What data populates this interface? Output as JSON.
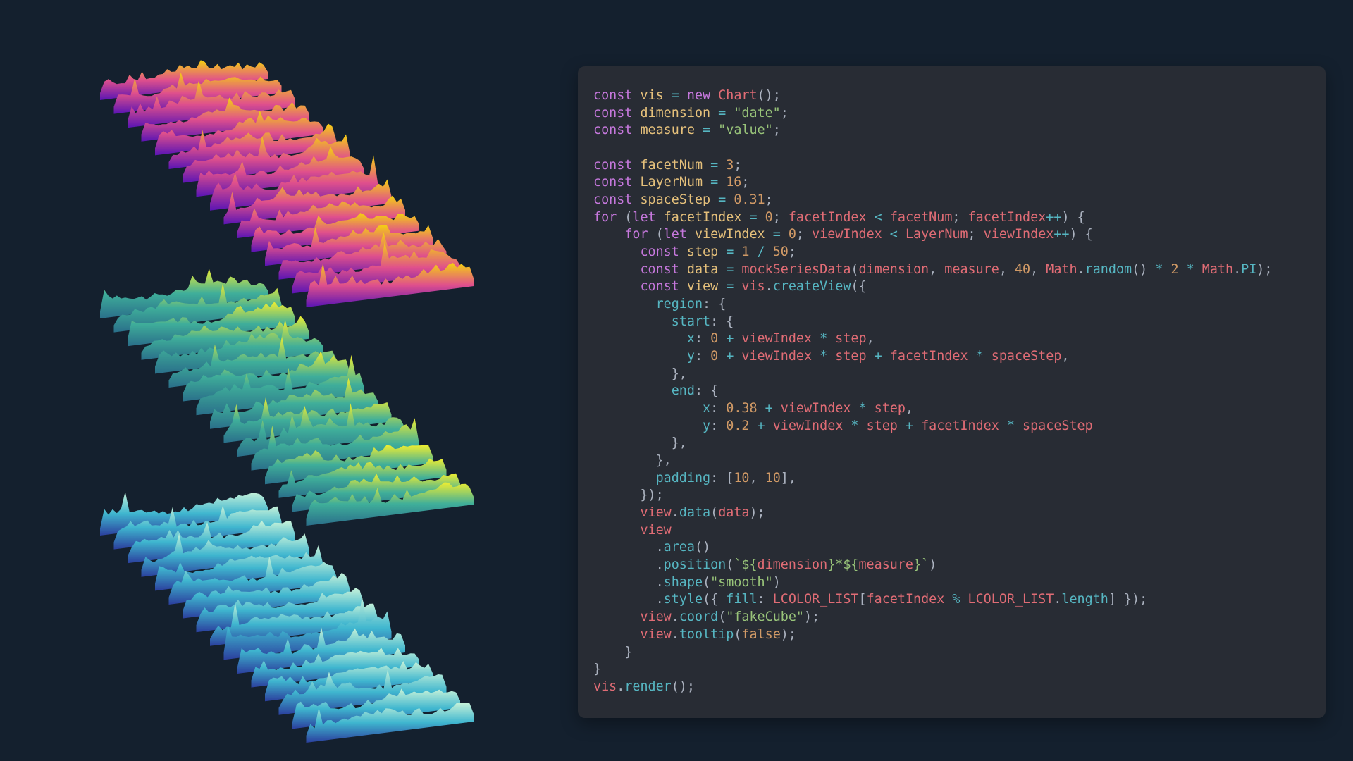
{
  "visualization": {
    "description_name": "stacked area layers",
    "facets": [
      {
        "gradient": {
          "top": "#f5d20f",
          "mid": "#e0508c",
          "bottom": "#5a14b4"
        },
        "layers": 16
      },
      {
        "gradient": {
          "top": "#f0ee30",
          "mid": "#3fae9a",
          "bottom": "#2a6f8a"
        },
        "layers": 16
      },
      {
        "gradient": {
          "top": "#c9f3d9",
          "mid": "#3fb6cf",
          "bottom": "#2b3f9e"
        },
        "layers": 16
      }
    ]
  },
  "code": {
    "lines": [
      [
        {
          "t": "k",
          "v": "const "
        },
        {
          "t": "v",
          "v": "vis"
        },
        {
          "t": "o",
          "v": " = "
        },
        {
          "t": "k",
          "v": "new "
        },
        {
          "t": "f",
          "v": "Chart"
        },
        {
          "t": "p",
          "v": "();"
        }
      ],
      [
        {
          "t": "k",
          "v": "const "
        },
        {
          "t": "v",
          "v": "dimension"
        },
        {
          "t": "o",
          "v": " = "
        },
        {
          "t": "s",
          "v": "\"date\""
        },
        {
          "t": "p",
          "v": ";"
        }
      ],
      [
        {
          "t": "k",
          "v": "const "
        },
        {
          "t": "v",
          "v": "measure"
        },
        {
          "t": "o",
          "v": " = "
        },
        {
          "t": "s",
          "v": "\"value\""
        },
        {
          "t": "p",
          "v": ";"
        }
      ],
      [],
      [
        {
          "t": "k",
          "v": "const "
        },
        {
          "t": "v",
          "v": "facetNum"
        },
        {
          "t": "o",
          "v": " = "
        },
        {
          "t": "n",
          "v": "3"
        },
        {
          "t": "p",
          "v": ";"
        }
      ],
      [
        {
          "t": "k",
          "v": "const "
        },
        {
          "t": "v",
          "v": "LayerNum"
        },
        {
          "t": "o",
          "v": " = "
        },
        {
          "t": "n",
          "v": "16"
        },
        {
          "t": "p",
          "v": ";"
        }
      ],
      [
        {
          "t": "k",
          "v": "const "
        },
        {
          "t": "v",
          "v": "spaceStep"
        },
        {
          "t": "o",
          "v": " = "
        },
        {
          "t": "n",
          "v": "0.31"
        },
        {
          "t": "p",
          "v": ";"
        }
      ],
      [
        {
          "t": "k",
          "v": "for "
        },
        {
          "t": "p",
          "v": "("
        },
        {
          "t": "k",
          "v": "let "
        },
        {
          "t": "v",
          "v": "facetIndex"
        },
        {
          "t": "o",
          "v": " = "
        },
        {
          "t": "n",
          "v": "0"
        },
        {
          "t": "p",
          "v": "; "
        },
        {
          "t": "f",
          "v": "facetIndex"
        },
        {
          "t": "o",
          "v": " < "
        },
        {
          "t": "f",
          "v": "facetNum"
        },
        {
          "t": "p",
          "v": "; "
        },
        {
          "t": "f",
          "v": "facetIndex"
        },
        {
          "t": "o",
          "v": "++"
        },
        {
          "t": "p",
          "v": ") {"
        }
      ],
      [
        {
          "t": "x",
          "v": "    "
        },
        {
          "t": "k",
          "v": "for "
        },
        {
          "t": "p",
          "v": "("
        },
        {
          "t": "k",
          "v": "let "
        },
        {
          "t": "v",
          "v": "viewIndex"
        },
        {
          "t": "o",
          "v": " = "
        },
        {
          "t": "n",
          "v": "0"
        },
        {
          "t": "p",
          "v": "; "
        },
        {
          "t": "f",
          "v": "viewIndex"
        },
        {
          "t": "o",
          "v": " < "
        },
        {
          "t": "f",
          "v": "LayerNum"
        },
        {
          "t": "p",
          "v": "; "
        },
        {
          "t": "f",
          "v": "viewIndex"
        },
        {
          "t": "o",
          "v": "++"
        },
        {
          "t": "p",
          "v": ") {"
        }
      ],
      [
        {
          "t": "x",
          "v": "      "
        },
        {
          "t": "k",
          "v": "const "
        },
        {
          "t": "v",
          "v": "step"
        },
        {
          "t": "o",
          "v": " = "
        },
        {
          "t": "n",
          "v": "1"
        },
        {
          "t": "o",
          "v": " / "
        },
        {
          "t": "n",
          "v": "50"
        },
        {
          "t": "p",
          "v": ";"
        }
      ],
      [
        {
          "t": "x",
          "v": "      "
        },
        {
          "t": "k",
          "v": "const "
        },
        {
          "t": "v",
          "v": "data"
        },
        {
          "t": "o",
          "v": " = "
        },
        {
          "t": "f",
          "v": "mockSeriesData"
        },
        {
          "t": "p",
          "v": "("
        },
        {
          "t": "f",
          "v": "dimension"
        },
        {
          "t": "p",
          "v": ", "
        },
        {
          "t": "f",
          "v": "measure"
        },
        {
          "t": "p",
          "v": ", "
        },
        {
          "t": "n",
          "v": "40"
        },
        {
          "t": "p",
          "v": ", "
        },
        {
          "t": "f",
          "v": "Math"
        },
        {
          "t": "p",
          "v": "."
        },
        {
          "t": "o",
          "v": "random"
        },
        {
          "t": "p",
          "v": "()"
        },
        {
          "t": "o",
          "v": " * "
        },
        {
          "t": "n",
          "v": "2"
        },
        {
          "t": "o",
          "v": " * "
        },
        {
          "t": "f",
          "v": "Math"
        },
        {
          "t": "p",
          "v": "."
        },
        {
          "t": "o",
          "v": "PI"
        },
        {
          "t": "p",
          "v": ");"
        }
      ],
      [
        {
          "t": "x",
          "v": "      "
        },
        {
          "t": "k",
          "v": "const "
        },
        {
          "t": "v",
          "v": "view"
        },
        {
          "t": "o",
          "v": " = "
        },
        {
          "t": "f",
          "v": "vis"
        },
        {
          "t": "p",
          "v": "."
        },
        {
          "t": "o",
          "v": "createView"
        },
        {
          "t": "p",
          "v": "({"
        }
      ],
      [
        {
          "t": "x",
          "v": "        "
        },
        {
          "t": "o",
          "v": "region"
        },
        {
          "t": "p",
          "v": ": {"
        }
      ],
      [
        {
          "t": "x",
          "v": "          "
        },
        {
          "t": "o",
          "v": "start"
        },
        {
          "t": "p",
          "v": ": {"
        }
      ],
      [
        {
          "t": "x",
          "v": "            "
        },
        {
          "t": "o",
          "v": "x"
        },
        {
          "t": "p",
          "v": ": "
        },
        {
          "t": "n",
          "v": "0"
        },
        {
          "t": "o",
          "v": " + "
        },
        {
          "t": "f",
          "v": "viewIndex"
        },
        {
          "t": "o",
          "v": " * "
        },
        {
          "t": "f",
          "v": "step"
        },
        {
          "t": "p",
          "v": ","
        }
      ],
      [
        {
          "t": "x",
          "v": "            "
        },
        {
          "t": "o",
          "v": "y"
        },
        {
          "t": "p",
          "v": ": "
        },
        {
          "t": "n",
          "v": "0"
        },
        {
          "t": "o",
          "v": " + "
        },
        {
          "t": "f",
          "v": "viewIndex"
        },
        {
          "t": "o",
          "v": " * "
        },
        {
          "t": "f",
          "v": "step"
        },
        {
          "t": "o",
          "v": " + "
        },
        {
          "t": "f",
          "v": "facetIndex"
        },
        {
          "t": "o",
          "v": " * "
        },
        {
          "t": "f",
          "v": "spaceStep"
        },
        {
          "t": "p",
          "v": ","
        }
      ],
      [
        {
          "t": "x",
          "v": "          "
        },
        {
          "t": "p",
          "v": "},"
        }
      ],
      [
        {
          "t": "x",
          "v": "          "
        },
        {
          "t": "o",
          "v": "end"
        },
        {
          "t": "p",
          "v": ": {"
        }
      ],
      [
        {
          "t": "x",
          "v": "              "
        },
        {
          "t": "o",
          "v": "x"
        },
        {
          "t": "p",
          "v": ": "
        },
        {
          "t": "n",
          "v": "0.38"
        },
        {
          "t": "o",
          "v": " + "
        },
        {
          "t": "f",
          "v": "viewIndex"
        },
        {
          "t": "o",
          "v": " * "
        },
        {
          "t": "f",
          "v": "step"
        },
        {
          "t": "p",
          "v": ","
        }
      ],
      [
        {
          "t": "x",
          "v": "              "
        },
        {
          "t": "o",
          "v": "y"
        },
        {
          "t": "p",
          "v": ": "
        },
        {
          "t": "n",
          "v": "0.2"
        },
        {
          "t": "o",
          "v": " + "
        },
        {
          "t": "f",
          "v": "viewIndex"
        },
        {
          "t": "o",
          "v": " * "
        },
        {
          "t": "f",
          "v": "step"
        },
        {
          "t": "o",
          "v": " + "
        },
        {
          "t": "f",
          "v": "facetIndex"
        },
        {
          "t": "o",
          "v": " * "
        },
        {
          "t": "f",
          "v": "spaceStep"
        }
      ],
      [
        {
          "t": "x",
          "v": "          "
        },
        {
          "t": "p",
          "v": "},"
        }
      ],
      [
        {
          "t": "x",
          "v": "        "
        },
        {
          "t": "p",
          "v": "},"
        }
      ],
      [
        {
          "t": "x",
          "v": "        "
        },
        {
          "t": "o",
          "v": "padding"
        },
        {
          "t": "p",
          "v": ": ["
        },
        {
          "t": "n",
          "v": "10"
        },
        {
          "t": "p",
          "v": ", "
        },
        {
          "t": "n",
          "v": "10"
        },
        {
          "t": "p",
          "v": "],"
        }
      ],
      [
        {
          "t": "x",
          "v": "      "
        },
        {
          "t": "p",
          "v": "});"
        }
      ],
      [
        {
          "t": "x",
          "v": "      "
        },
        {
          "t": "f",
          "v": "view"
        },
        {
          "t": "p",
          "v": "."
        },
        {
          "t": "o",
          "v": "data"
        },
        {
          "t": "p",
          "v": "("
        },
        {
          "t": "f",
          "v": "data"
        },
        {
          "t": "p",
          "v": ");"
        }
      ],
      [
        {
          "t": "x",
          "v": "      "
        },
        {
          "t": "f",
          "v": "view"
        }
      ],
      [
        {
          "t": "x",
          "v": "        "
        },
        {
          "t": "p",
          "v": "."
        },
        {
          "t": "o",
          "v": "area"
        },
        {
          "t": "p",
          "v": "()"
        }
      ],
      [
        {
          "t": "x",
          "v": "        "
        },
        {
          "t": "p",
          "v": "."
        },
        {
          "t": "o",
          "v": "position"
        },
        {
          "t": "p",
          "v": "("
        },
        {
          "t": "s",
          "v": "`${"
        },
        {
          "t": "f",
          "v": "dimension"
        },
        {
          "t": "s",
          "v": "}*${"
        },
        {
          "t": "f",
          "v": "measure"
        },
        {
          "t": "s",
          "v": "}`"
        },
        {
          "t": "p",
          "v": ")"
        }
      ],
      [
        {
          "t": "x",
          "v": "        "
        },
        {
          "t": "p",
          "v": "."
        },
        {
          "t": "o",
          "v": "shape"
        },
        {
          "t": "p",
          "v": "("
        },
        {
          "t": "s",
          "v": "\"smooth\""
        },
        {
          "t": "p",
          "v": ")"
        }
      ],
      [
        {
          "t": "x",
          "v": "        "
        },
        {
          "t": "p",
          "v": "."
        },
        {
          "t": "o",
          "v": "style"
        },
        {
          "t": "p",
          "v": "({ "
        },
        {
          "t": "o",
          "v": "fill"
        },
        {
          "t": "p",
          "v": ": "
        },
        {
          "t": "f",
          "v": "LCOLOR_LIST"
        },
        {
          "t": "p",
          "v": "["
        },
        {
          "t": "f",
          "v": "facetIndex"
        },
        {
          "t": "o",
          "v": " % "
        },
        {
          "t": "f",
          "v": "LCOLOR_LIST"
        },
        {
          "t": "p",
          "v": "."
        },
        {
          "t": "o",
          "v": "length"
        },
        {
          "t": "p",
          "v": "] });"
        }
      ],
      [
        {
          "t": "x",
          "v": "      "
        },
        {
          "t": "f",
          "v": "view"
        },
        {
          "t": "p",
          "v": "."
        },
        {
          "t": "o",
          "v": "coord"
        },
        {
          "t": "p",
          "v": "("
        },
        {
          "t": "s",
          "v": "\"fakeCube\""
        },
        {
          "t": "p",
          "v": ");"
        }
      ],
      [
        {
          "t": "x",
          "v": "      "
        },
        {
          "t": "f",
          "v": "view"
        },
        {
          "t": "p",
          "v": "."
        },
        {
          "t": "o",
          "v": "tooltip"
        },
        {
          "t": "p",
          "v": "("
        },
        {
          "t": "n",
          "v": "false"
        },
        {
          "t": "p",
          "v": ");"
        }
      ],
      [
        {
          "t": "x",
          "v": "    "
        },
        {
          "t": "p",
          "v": "}"
        }
      ],
      [
        {
          "t": "p",
          "v": "}"
        }
      ],
      [
        {
          "t": "f",
          "v": "vis"
        },
        {
          "t": "p",
          "v": "."
        },
        {
          "t": "o",
          "v": "render"
        },
        {
          "t": "p",
          "v": "();"
        }
      ]
    ]
  }
}
